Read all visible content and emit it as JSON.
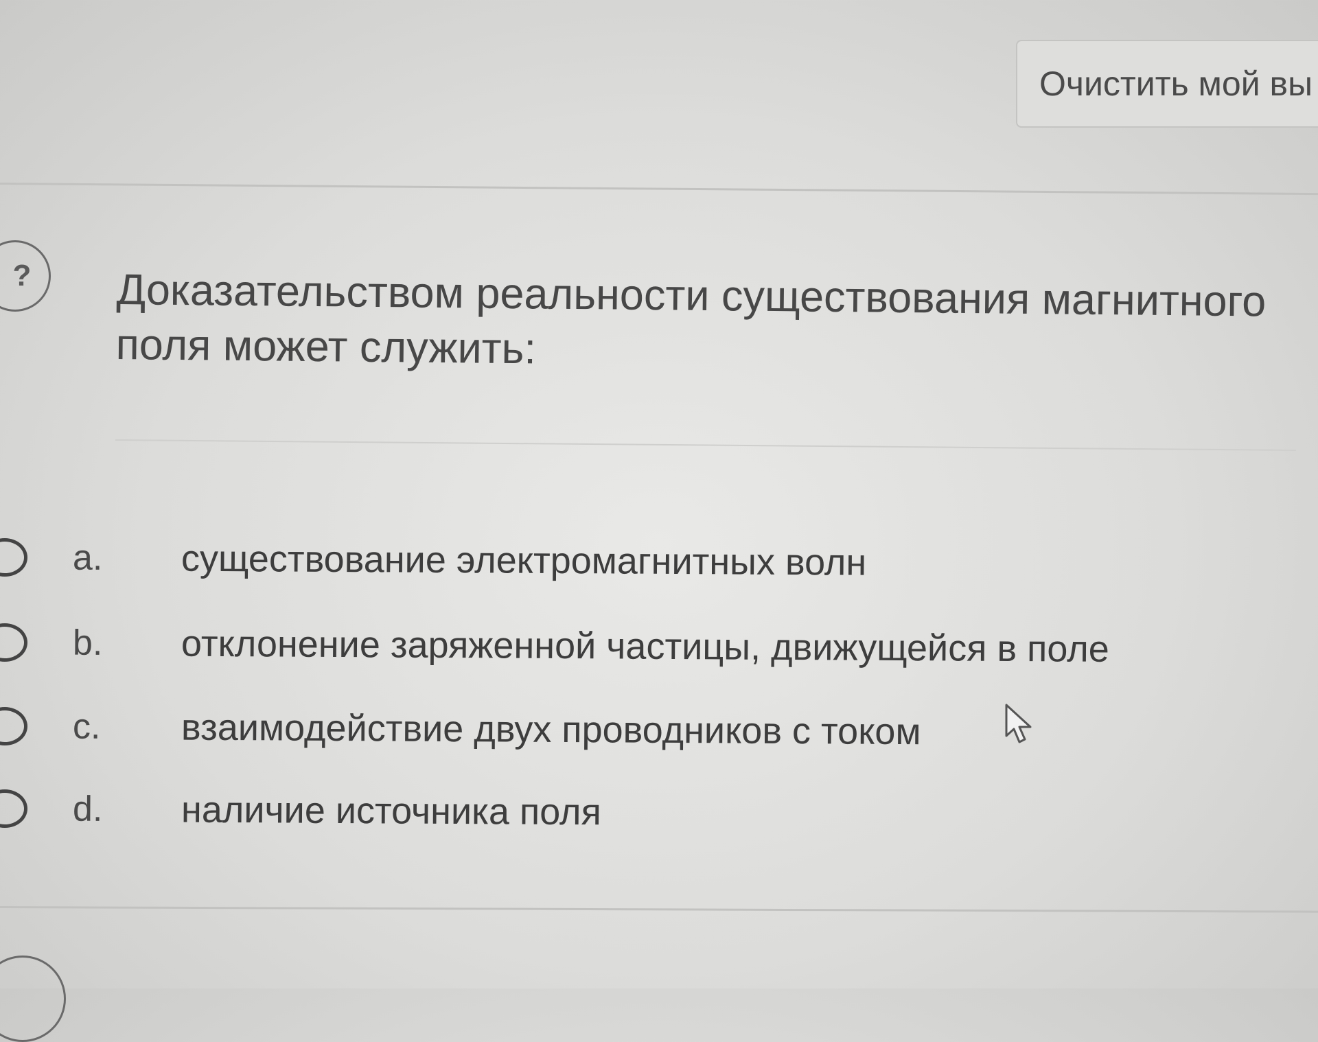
{
  "toolbar": {
    "clear_label": "Очистить мой вы"
  },
  "question": {
    "badge_icon": "?",
    "text": "Доказательством реальности существования магнитного поля может служить:",
    "answers": [
      {
        "letter": "a.",
        "text": "существование электромагнитных волн",
        "selected": false
      },
      {
        "letter": "b.",
        "text": "отклонение заряженной частицы, движущейся в поле",
        "selected": false
      },
      {
        "letter": "c.",
        "text": "взаимодействие двух проводников с током",
        "selected": false
      },
      {
        "letter": "d.",
        "text": "наличие источника поля",
        "selected": false
      }
    ]
  },
  "icons": {
    "question_badge": "question-mark-icon",
    "cursor": "mouse-pointer-icon"
  }
}
